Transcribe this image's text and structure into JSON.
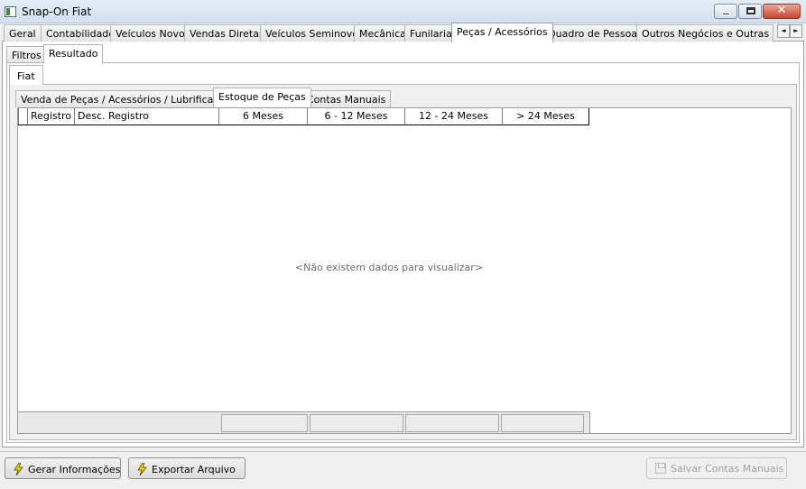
{
  "window": {
    "title": "Snap-On Fiat",
    "minimize_icon": "minimize-icon",
    "maximize_icon": "maximize-icon",
    "close_glyph": "✕"
  },
  "top_tabs": [
    {
      "label": "Geral"
    },
    {
      "label": "Contabilidade"
    },
    {
      "label": "Veículos Novos"
    },
    {
      "label": "Vendas Diretas"
    },
    {
      "label": "Veículos Seminovos"
    },
    {
      "label": "Mecânica"
    },
    {
      "label": "Funilaria"
    },
    {
      "label": "Peças / Acessórios",
      "active": true
    },
    {
      "label": "Quadro de Pessoas"
    },
    {
      "label": "Outros Negócios e Outras Mar"
    }
  ],
  "tab_scroll": {
    "left": "◄",
    "right": "►"
  },
  "view_tabs": [
    {
      "label": "Filtros"
    },
    {
      "label": "Resultado",
      "active": true
    }
  ],
  "brand_tab": {
    "label": "Fiat"
  },
  "section_tabs": [
    {
      "label": "Venda de Peças / Acessórios / Lubrificantes"
    },
    {
      "label": "Estoque de Peças",
      "active": true
    },
    {
      "label": "Contas Manuais"
    }
  ],
  "grid": {
    "columns": [
      {
        "label": "Registro"
      },
      {
        "label": "Desc. Registro"
      },
      {
        "label": "6 Meses"
      },
      {
        "label": "6 - 12 Meses"
      },
      {
        "label": "12 - 24 Meses"
      },
      {
        "label": "> 24 Meses"
      }
    ],
    "empty_message": "<Não existem dados para visualizar>"
  },
  "buttons": {
    "generate": "Gerar Informações",
    "export": "Exportar Arquivo",
    "save_manual": "Salvar Contas Manuais"
  },
  "colors": {
    "bolt": "#f5d400",
    "bolt_stroke": "#4a4a00"
  }
}
